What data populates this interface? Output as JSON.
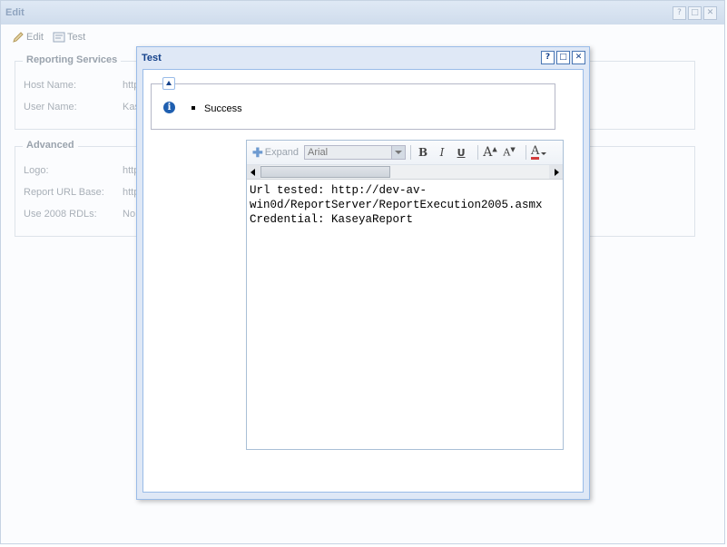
{
  "edit_window": {
    "title": "Edit",
    "toolbar": {
      "edit_label": "Edit",
      "test_label": "Test"
    },
    "reporting_services": {
      "legend": "Reporting Services",
      "fields": [
        {
          "label": "Host Name:",
          "value": "http"
        },
        {
          "label": "User Name:",
          "value": "Kas"
        }
      ]
    },
    "advanced": {
      "legend": "Advanced",
      "fields": [
        {
          "label": "Logo:",
          "value": "http"
        },
        {
          "label": "Report URL Base:",
          "value": "http"
        },
        {
          "label": "Use 2008 RDLs:",
          "value": "No"
        }
      ]
    }
  },
  "test_dialog": {
    "title": "Test",
    "result": {
      "icon": "info-icon",
      "items": [
        "Success"
      ]
    },
    "editor": {
      "expand_label": "Expand",
      "font_value": "Arial",
      "content": "Url tested: http://dev-av-\nwin0d/ReportServer/ReportExecution2005.asmx\nCredential: KaseyaReport"
    }
  },
  "colors": {
    "dialog_title": "#15428b",
    "dialog_border": "#99bbe8",
    "info_icon": "#1f5fb0",
    "font_color_bar": "#d23c3c"
  }
}
